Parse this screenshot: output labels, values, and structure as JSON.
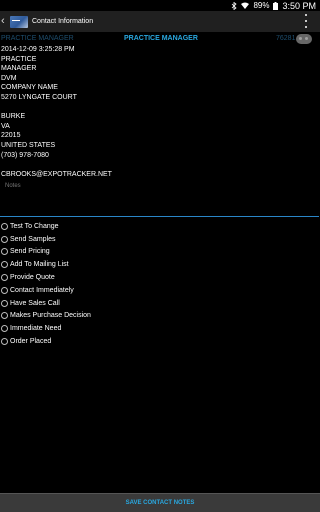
{
  "status_bar": {
    "battery": "89%",
    "time": "3:50 PM"
  },
  "action_bar": {
    "title": "Contact Information"
  },
  "tabs": [
    "PRACTICE MANAGER",
    "PRACTICE MANAGER",
    "76281"
  ],
  "contact": {
    "timestamp": "2014-12-09 3:25:28 PM",
    "title_line1": "PRACTICE",
    "title_line2": "MANAGER",
    "credential": "DVM",
    "company": "COMPANY NAME",
    "street": "5270 LYNGATE COURT",
    "city": "BURKE",
    "state": "VA",
    "zip": "22015",
    "country": "UNITED STATES",
    "phone": "(703) 978-7080",
    "email": "CBROOKS@EXPOTRACKER.NET"
  },
  "notes": {
    "placeholder": "Notes",
    "value": ""
  },
  "checklist": [
    "Test To Change",
    "Send Samples",
    "Send Pricing",
    "Add To Mailing List",
    "Provide Quote",
    "Contact Immediately",
    "Have Sales Call",
    "Makes Purchase Decision",
    "Immediate Need",
    "Order Placed"
  ],
  "save_button": "SAVE CONTACT NOTES",
  "colors": {
    "accent": "#29a8e0",
    "background": "#000000",
    "action_bar": "#202020"
  },
  "icons": [
    "bluetooth-icon",
    "wifi-icon",
    "battery-icon",
    "back-arrow-icon",
    "app-logo-icon",
    "overflow-menu-icon"
  ]
}
